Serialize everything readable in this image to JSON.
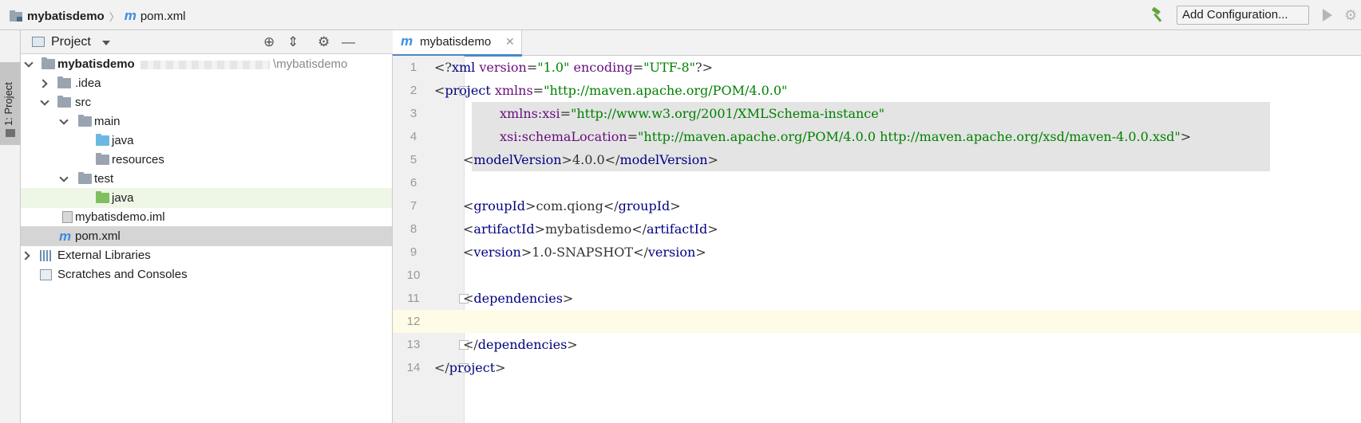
{
  "topbar": {
    "project": "mybatisdemo",
    "file": "pom.xml",
    "add_configuration": "Add Configuration..."
  },
  "sidebar_strip": {
    "label": "1: Project"
  },
  "project_panel": {
    "title": "Project",
    "root_name": "mybatisdemo",
    "root_path": "\\mybatisdemo",
    "items": {
      "idea": ".idea",
      "src": "src",
      "main": "main",
      "java_main": "java",
      "resources": "resources",
      "test": "test",
      "java_test": "java",
      "iml": "mybatisdemo.iml",
      "pom": "pom.xml",
      "ext_libs": "External Libraries",
      "scratches": "Scratches and Consoles"
    }
  },
  "editor": {
    "tab_label": "mybatisdemo",
    "lines": [
      {
        "n": "1"
      },
      {
        "n": "2"
      },
      {
        "n": "3"
      },
      {
        "n": "4"
      },
      {
        "n": "5"
      },
      {
        "n": "6"
      },
      {
        "n": "7"
      },
      {
        "n": "8"
      },
      {
        "n": "9"
      },
      {
        "n": "10"
      },
      {
        "n": "11"
      },
      {
        "n": "12"
      },
      {
        "n": "13"
      },
      {
        "n": "14"
      }
    ],
    "code": {
      "l1_lt": "<?",
      "l1_tag": "xml",
      "l1_a1": " version",
      "l1_eq1": "=",
      "l1_v1": "\"1.0\"",
      "l1_a2": " encoding",
      "l1_eq2": "=",
      "l1_v2": "\"UTF-8\"",
      "l1_end": "?>",
      "l2_lt": "<",
      "l2_tag": "project",
      "l2_a": " xmlns",
      "l2_eq": "=",
      "l2_v": "\"http://maven.apache.org/POM/4.0.0\"",
      "l3_a": "xmlns:xsi",
      "l3_eq": "=",
      "l3_v": "\"http://www.w3.org/2001/XMLSchema-instance\"",
      "l4_a": "xsi:schemaLocation",
      "l4_eq": "=",
      "l4_v": "\"http://maven.apache.org/POM/4.0.0 http://maven.apache.org/xsd/maven-4.0.0.xsd\"",
      "l4_gt": ">",
      "l5_open": "modelVersion",
      "l5_val": "4.0.0",
      "l5_close": "modelVersion",
      "l7_open": "groupId",
      "l7_val": "com.qiong",
      "l7_close": "groupId",
      "l8_open": "artifactId",
      "l8_val": "mybatisdemo",
      "l8_close": "artifactId",
      "l9_open": "version",
      "l9_val": "1.0-SNAPSHOT",
      "l9_close": "version",
      "l11_tag": "dependencies",
      "l13_tag": "dependencies",
      "l14_tag": "project",
      "lt": "<",
      "gt": ">",
      "lts": "</"
    }
  },
  "colors": {
    "tag": "#000080",
    "attr": "#660e7a",
    "string": "#008000",
    "current_line": "#fefbe6",
    "selection": "#e4e4e4"
  }
}
